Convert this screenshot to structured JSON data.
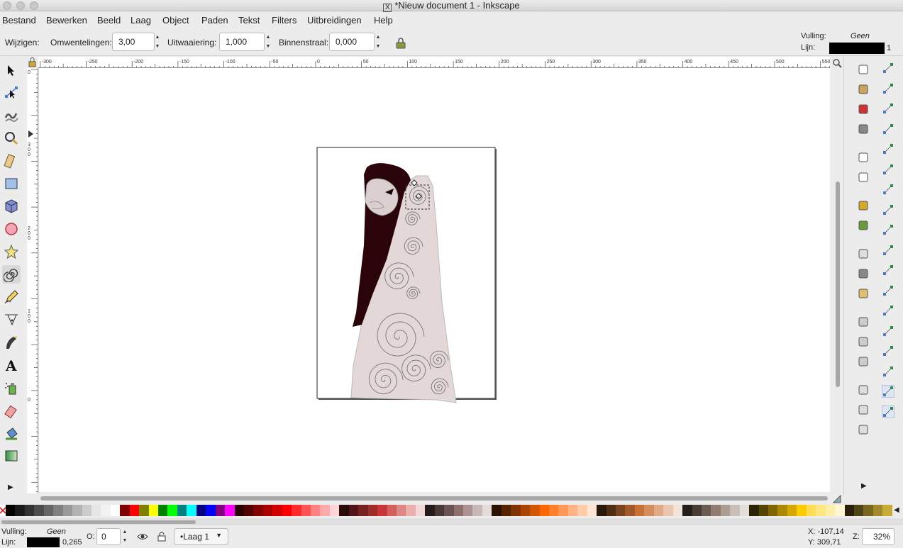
{
  "window": {
    "title": "*Nieuw document 1 - Inkscape",
    "x_logo": "X"
  },
  "menu": [
    "Bestand",
    "Bewerken",
    "Beeld",
    "Laag",
    "Object",
    "Paden",
    "Tekst",
    "Filters",
    "Uitbreidingen",
    "Help"
  ],
  "spiral_toolbar": {
    "mode_label": "Wijzigen:",
    "turns_label": "Omwentelingen:",
    "turns_value": "3,00",
    "divergence_label": "Uitwaaiering:",
    "divergence_value": "1,000",
    "inner_radius_label": "Binnenstraal:",
    "inner_radius_value": "0,000"
  },
  "style_indicator": {
    "fill_label": "Vulling:",
    "fill_value": "Geen",
    "stroke_label": "Lijn:",
    "stroke_width": "1"
  },
  "ruler_h_labels": [
    "-300",
    "-250",
    "-200",
    "-150",
    "-100",
    "-50",
    "0",
    "50",
    "100",
    "150",
    "200",
    "250",
    "300",
    "350",
    "400",
    "450",
    "500",
    "550"
  ],
  "ruler_v_labels": [
    "0",
    "3 0 0",
    "2 0 0",
    "1 0 0",
    "0"
  ],
  "tools": [
    "selector-tool",
    "node-tool",
    "tweak-tool",
    "zoom-tool",
    "measure-tool",
    "rect-tool",
    "3dbox-tool",
    "ellipse-tool",
    "star-tool",
    "spiral-tool",
    "pencil-tool",
    "pen-tool",
    "calligraphy-tool",
    "text-tool",
    "spray-tool",
    "eraser-tool",
    "bucket-tool",
    "gradient-tool"
  ],
  "commands": [
    "new-doc",
    "open-doc",
    "save-doc",
    "print-doc",
    "import",
    "export",
    "undo",
    "redo",
    "copy",
    "cut",
    "paste",
    "zoom-selection",
    "zoom-drawing",
    "zoom-page",
    "duplicate",
    "group",
    "ungroup"
  ],
  "snap_commands": [
    "snap-toggle",
    "snap-bbox",
    "snap-bbox-edge",
    "snap-bbox-corner",
    "snap-bbox-midpoint",
    "snap-bbox-center",
    "snap-nodes",
    "snap-path",
    "snap-intersection",
    "snap-cusp",
    "snap-smooth",
    "snap-midpoint",
    "snap-center",
    "snap-rotation-center",
    "snap-text-baseline",
    "snap-page",
    "snap-grid",
    "snap-guide"
  ],
  "palette_colors": [
    "#000000",
    "#1a1a1a",
    "#333333",
    "#4d4d4d",
    "#666666",
    "#808080",
    "#999999",
    "#b3b3b3",
    "#cccccc",
    "#e6e6e6",
    "#f2f2f2",
    "#ffffff",
    "#800000",
    "#ff0000",
    "#808000",
    "#ffff00",
    "#008000",
    "#00ff00",
    "#008080",
    "#00ffff",
    "#000080",
    "#0000ff",
    "#800080",
    "#ff00ff",
    "#2b0000",
    "#550000",
    "#800000",
    "#aa0000",
    "#d40000",
    "#ff0000",
    "#ff2a2a",
    "#ff5555",
    "#ff8080",
    "#ffaaaa",
    "#ffd5d5",
    "#280b0b",
    "#501616",
    "#782121",
    "#a02c2c",
    "#c83737",
    "#d35f5f",
    "#de8787",
    "#e9afaf",
    "#f4d7d7",
    "#241c1c",
    "#483737",
    "#6c5353",
    "#916f6f",
    "#ac9393",
    "#c8b7b7",
    "#e3dbdb",
    "#2b1100",
    "#552200",
    "#803300",
    "#aa4400",
    "#d45500",
    "#ff6600",
    "#ff7f2a",
    "#ff9955",
    "#ffb380",
    "#ffccaa",
    "#ffe6d5",
    "#28170b",
    "#502d16",
    "#784421",
    "#a05a2c",
    "#c87137",
    "#d38d5f",
    "#deaa87",
    "#e9c6af",
    "#f4e3d7",
    "#241f1c",
    "#483e37",
    "#6c5d53",
    "#917c6f",
    "#ac9d93",
    "#c8beb7",
    "#e3dedb",
    "#2b2200",
    "#554400",
    "#806600",
    "#aa8800",
    "#d4aa00",
    "#ffcc00",
    "#ffdd55",
    "#ffe680",
    "#ffeeaa",
    "#fff6d5",
    "#28220b",
    "#504416",
    "#786721",
    "#a0892c",
    "#c8ab37"
  ],
  "status": {
    "fill_label": "Vulling:",
    "fill_value": "Geen",
    "stroke_label": "Lijn:",
    "stroke_width": "0,265",
    "opacity_label": "O:",
    "opacity_value": "0",
    "layer": "•Laag 1",
    "x_coord": "X: -107,14",
    "y_coord": "Y: 309,71",
    "zoom_label": "Z:",
    "zoom_value": "32%"
  }
}
